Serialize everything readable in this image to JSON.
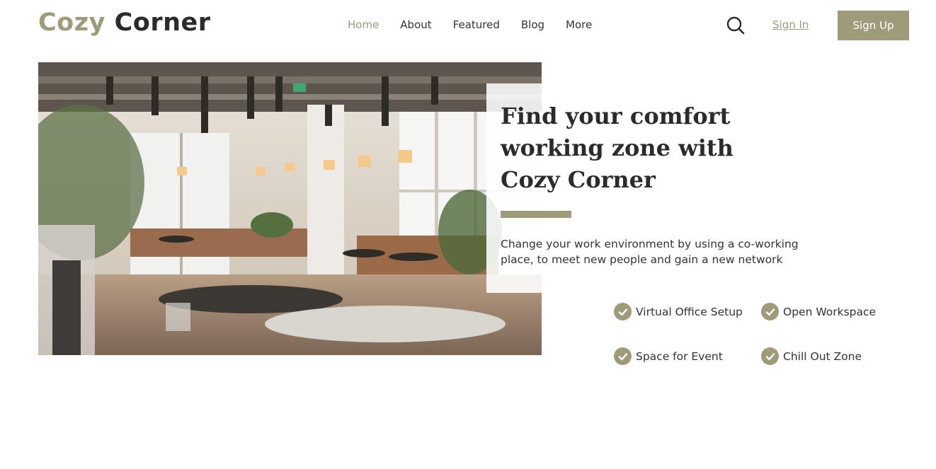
{
  "header": {
    "logo_first": "Cozy",
    "logo_second": "Corner",
    "nav": [
      {
        "label": "Home",
        "active": true
      },
      {
        "label": "About"
      },
      {
        "label": "Featured"
      },
      {
        "label": "Blog"
      },
      {
        "label": "More"
      }
    ],
    "search_icon": "search-icon",
    "signin_label": "Sign In",
    "signup_label": "Sign Up"
  },
  "hero": {
    "image": "cafe-coworking-interior-photo",
    "headline": "Find your comfort working zone with Cozy Corner",
    "subtext": "Change your work environment by using a co-working place, to meet new people and gain a new network",
    "features": [
      "Virtual Office Setup",
      "Open Workspace",
      "Space for Event",
      "Chill Out Zone"
    ],
    "feature_icon": "check-circle-icon"
  },
  "colors": {
    "accent": "#9d9b79",
    "text": "#2b2b2b",
    "background": "#ffffff"
  }
}
